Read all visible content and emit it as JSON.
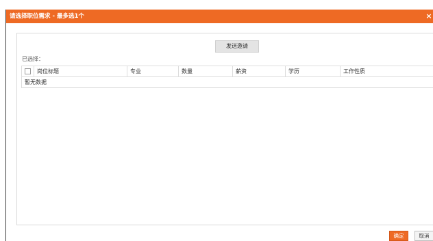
{
  "dialog": {
    "title": "请选择职位需求 - 最多选1个",
    "close_glyph": "×"
  },
  "main": {
    "send_button": "发送邀请",
    "selected_label": "已选择："
  },
  "table": {
    "columns": [
      "岗位标题",
      "专业",
      "数量",
      "薪资",
      "学历",
      "工作性质"
    ],
    "empty_text": "暂无数据"
  },
  "footer": {
    "ok_label": "确定",
    "cancel_label": "取消"
  },
  "colors": {
    "accent": "#ee6a24"
  }
}
